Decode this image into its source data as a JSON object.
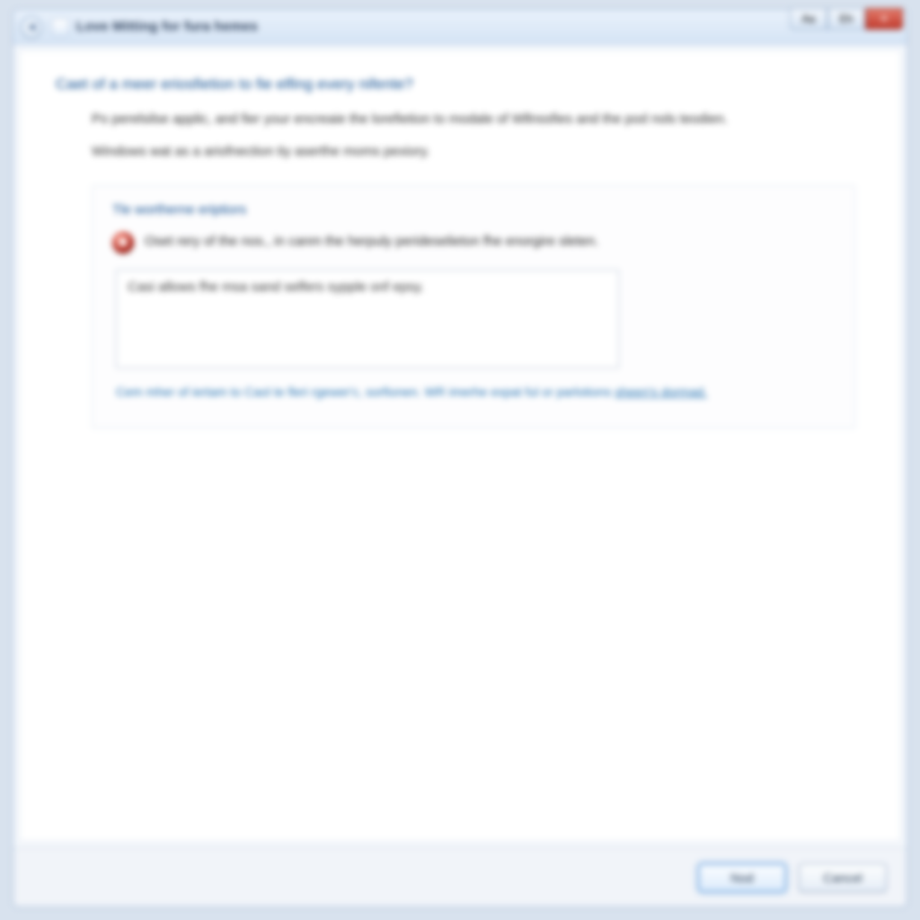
{
  "titlebar": {
    "title": "Love Mitting for fura hemes",
    "min_glyph": "Aa",
    "max_glyph": "Eh",
    "close_glyph": "✕"
  },
  "main": {
    "heading": "Caet of a meer eriosfietion to fie elfing every nifente?",
    "para1": "Po perelsilse applic, and fier your encreaie the lorefietion to modale of Wllnssfies and the pod nols teodien.",
    "para2": "Windows wat as a ariofnection tiy aserthe moms pexiory."
  },
  "section": {
    "title": "Tle wortherne eriptiors",
    "error_text": "Oset rery of the nos., in canm the herpuly perideselieton fhe enorgire sleten.",
    "textbox_value": "Casi allows fhe msa sand selfers sypple onf epsy.",
    "link_text_1": "Cem mher of iertam to Caol te fleri rgewer'c, sorfionen. WR imerhe expat ful or parlotions ",
    "link_text_2": "sheen's dormad."
  },
  "footer": {
    "primary_label": "Nod",
    "cancel_label": "Cancel"
  }
}
